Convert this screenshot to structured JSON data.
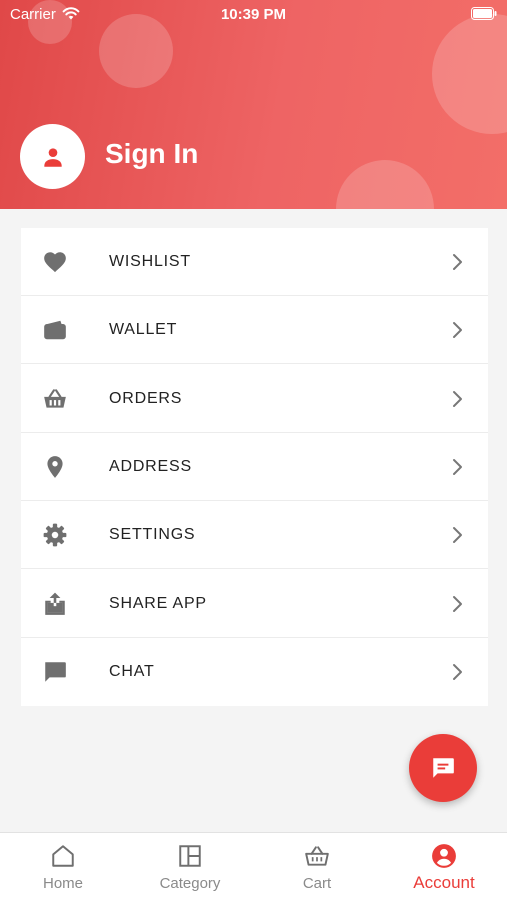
{
  "status_bar": {
    "carrier": "Carrier",
    "time": "10:39 PM"
  },
  "header": {
    "title": "Sign In",
    "avatar_icon": "person-icon"
  },
  "menu": [
    {
      "id": "wishlist",
      "label": "WISHLIST",
      "icon": "heart-icon"
    },
    {
      "id": "wallet",
      "label": "WALLET",
      "icon": "wallet-icon"
    },
    {
      "id": "orders",
      "label": "ORDERS",
      "icon": "basket-icon"
    },
    {
      "id": "address",
      "label": "ADDRESS",
      "icon": "location-pin-icon"
    },
    {
      "id": "settings",
      "label": "SETTINGS",
      "icon": "gear-icon"
    },
    {
      "id": "share-app",
      "label": "SHARE APP",
      "icon": "share-icon"
    },
    {
      "id": "chat",
      "label": "CHAT",
      "icon": "chat-icon"
    }
  ],
  "fab": {
    "icon": "chat-bubble-icon"
  },
  "tabbar": [
    {
      "id": "home",
      "label": "Home",
      "icon": "home-icon",
      "active": false
    },
    {
      "id": "category",
      "label": "Category",
      "icon": "category-icon",
      "active": false
    },
    {
      "id": "cart",
      "label": "Cart",
      "icon": "basket-icon",
      "active": false
    },
    {
      "id": "account",
      "label": "Account",
      "icon": "account-circle-icon",
      "active": true
    }
  ],
  "colors": {
    "accent": "#ea3d39",
    "icon_gray": "#6f6f6f",
    "header_start": "#e04848",
    "header_end": "#f36e68"
  }
}
